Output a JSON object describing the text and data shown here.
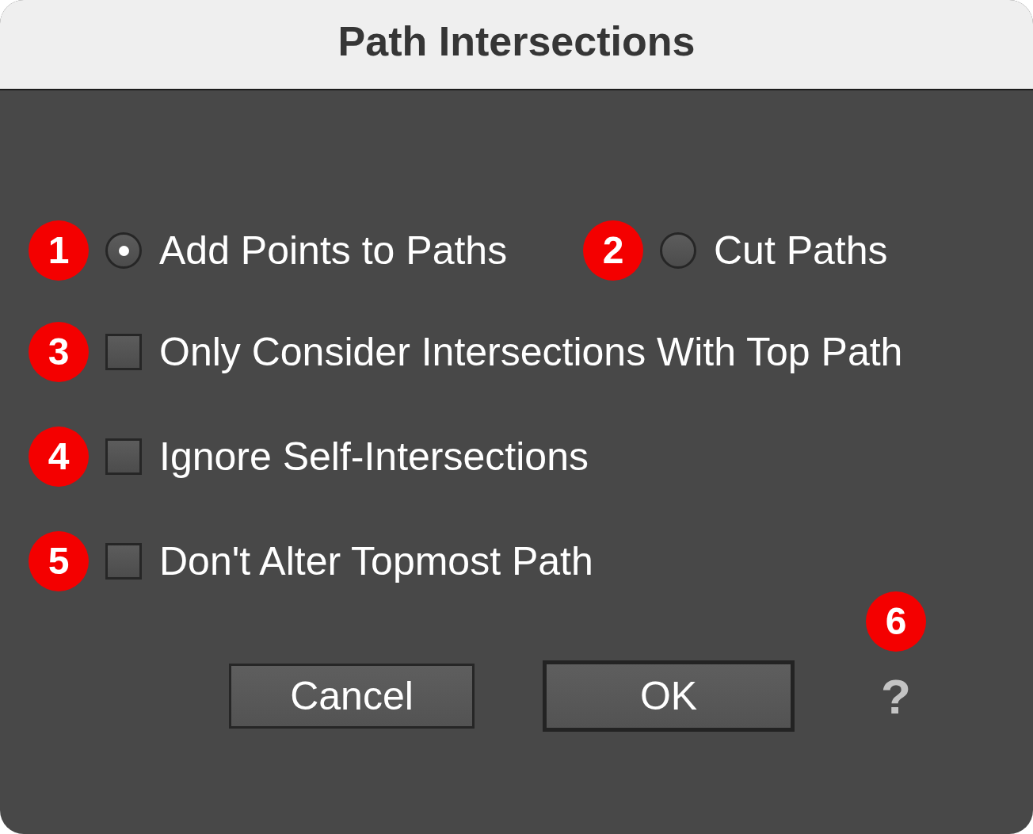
{
  "window": {
    "title": "Path Intersections"
  },
  "mode_options": [
    {
      "label": "Add Points to Paths",
      "selected": true,
      "callout": "1"
    },
    {
      "label": "Cut Paths",
      "selected": false,
      "callout": "2"
    }
  ],
  "checkboxes": [
    {
      "label": "Only Consider Intersections With Top Path",
      "checked": false,
      "callout": "3"
    },
    {
      "label": "Ignore Self-Intersections",
      "checked": false,
      "callout": "4"
    },
    {
      "label": "Don't Alter Topmost Path",
      "checked": false,
      "callout": "5"
    }
  ],
  "buttons": [
    {
      "label": "Cancel",
      "default": false
    },
    {
      "label": "OK",
      "default": true
    }
  ],
  "help": {
    "label": "?",
    "callout": "6"
  }
}
